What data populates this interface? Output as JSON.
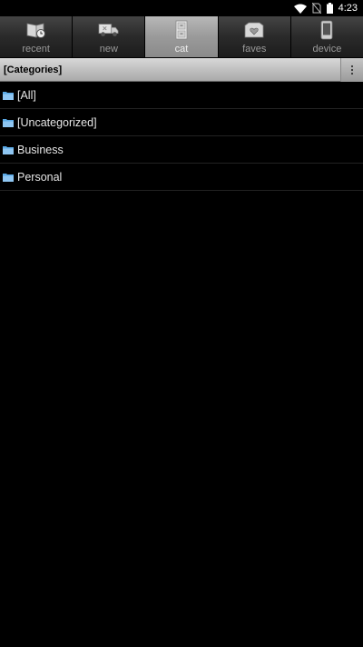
{
  "status_bar": {
    "time": "4:23",
    "icons": [
      "wifi-icon",
      "no-sim-icon",
      "battery-icon"
    ]
  },
  "tabs": [
    {
      "label": "recent",
      "icon": "recent-icon",
      "active": false
    },
    {
      "label": "new",
      "icon": "new-truck-icon",
      "active": false
    },
    {
      "label": "cat",
      "icon": "cabinet-icon",
      "active": true
    },
    {
      "label": "faves",
      "icon": "favorites-box-icon",
      "active": false
    },
    {
      "label": "device",
      "icon": "device-icon",
      "active": false
    }
  ],
  "header": {
    "title": "[Categories]",
    "menu_icon": "overflow-menu-icon"
  },
  "categories": [
    {
      "label": "[All]",
      "icon": "folder-icon"
    },
    {
      "label": "[Uncategorized]",
      "icon": "folder-icon"
    },
    {
      "label": "Business",
      "icon": "folder-icon"
    },
    {
      "label": "Personal",
      "icon": "folder-icon"
    }
  ],
  "colors": {
    "background": "#000000",
    "folder": "#5aa9e6",
    "active_tab": "#a8a8a8"
  }
}
